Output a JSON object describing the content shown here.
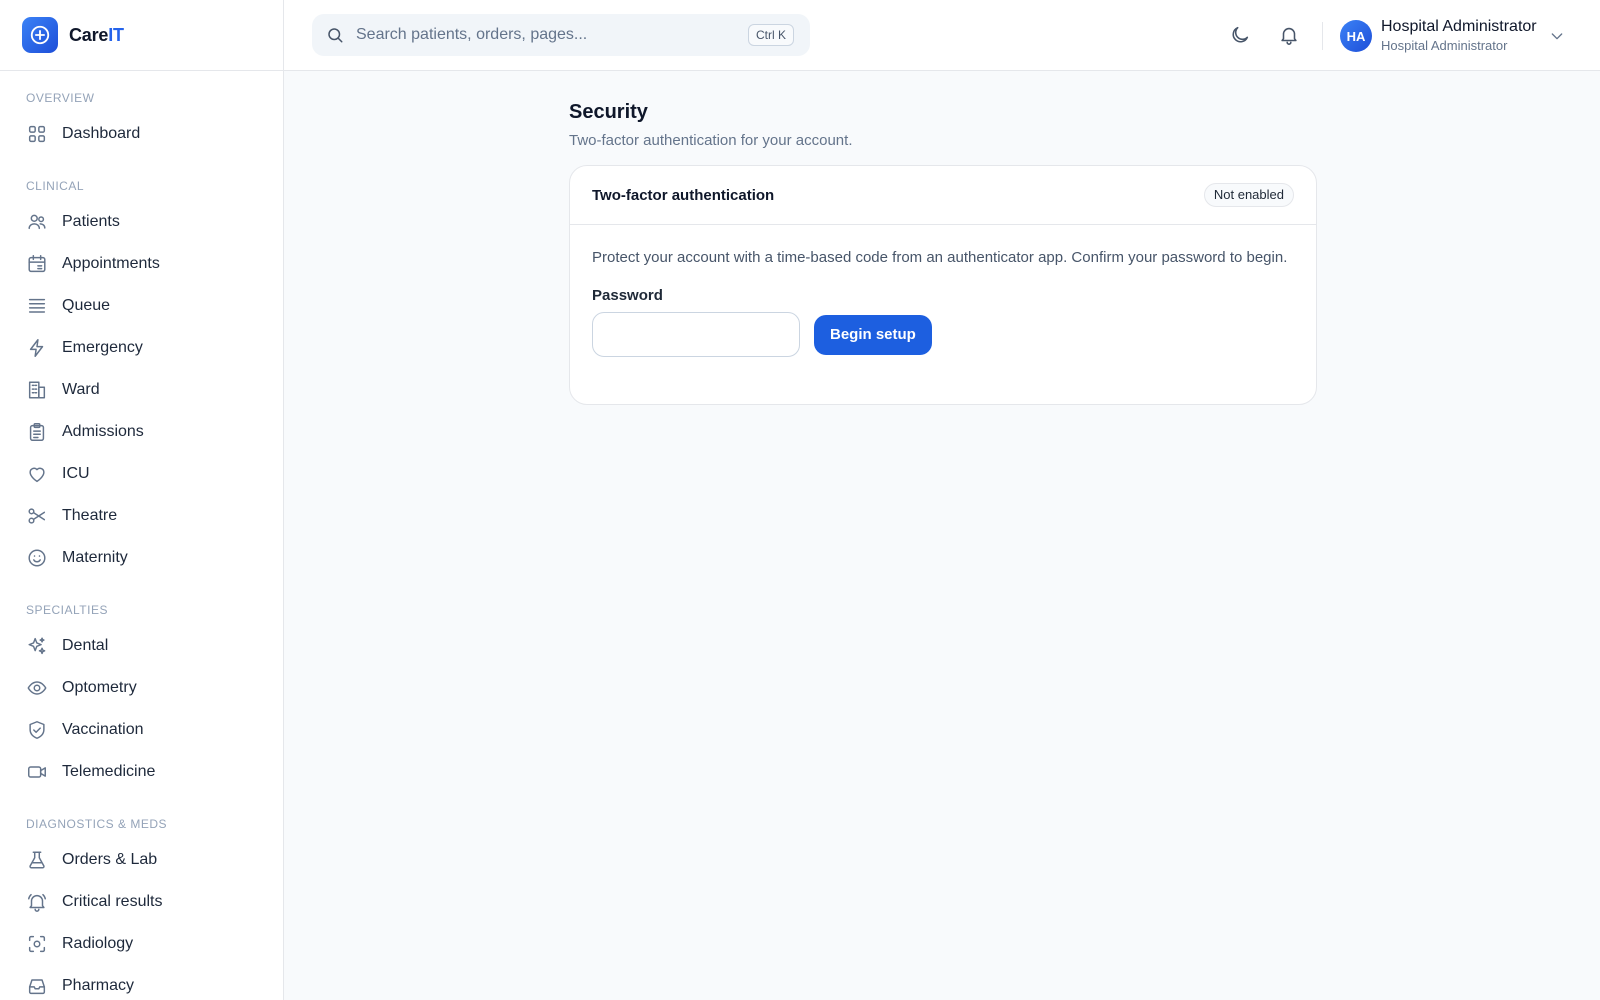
{
  "brand": {
    "name_main": "Care",
    "name_accent": "IT"
  },
  "search": {
    "placeholder": "Search patients, orders, pages...",
    "shortcut": "Ctrl K"
  },
  "user": {
    "initials": "HA",
    "name": "Hospital Administrator",
    "role": "Hospital Administrator"
  },
  "sidebar": {
    "sections": [
      {
        "label": "OVERVIEW",
        "items": [
          {
            "label": "Dashboard",
            "icon": "grid-icon"
          }
        ]
      },
      {
        "label": "CLINICAL",
        "items": [
          {
            "label": "Patients",
            "icon": "users-icon"
          },
          {
            "label": "Appointments",
            "icon": "calendar-icon"
          },
          {
            "label": "Queue",
            "icon": "list-icon"
          },
          {
            "label": "Emergency",
            "icon": "bolt-icon"
          },
          {
            "label": "Ward",
            "icon": "building-icon"
          },
          {
            "label": "Admissions",
            "icon": "clipboard-icon"
          },
          {
            "label": "ICU",
            "icon": "heart-icon"
          },
          {
            "label": "Theatre",
            "icon": "scissors-icon"
          },
          {
            "label": "Maternity",
            "icon": "smile-icon"
          }
        ]
      },
      {
        "label": "SPECIALTIES",
        "items": [
          {
            "label": "Dental",
            "icon": "sparkles-icon"
          },
          {
            "label": "Optometry",
            "icon": "eye-icon"
          },
          {
            "label": "Vaccination",
            "icon": "shield-check-icon"
          },
          {
            "label": "Telemedicine",
            "icon": "video-icon"
          }
        ]
      },
      {
        "label": "DIAGNOSTICS & MEDS",
        "items": [
          {
            "label": "Orders & Lab",
            "icon": "flask-icon"
          },
          {
            "label": "Critical results",
            "icon": "bell-alert-icon"
          },
          {
            "label": "Radiology",
            "icon": "scan-icon"
          },
          {
            "label": "Pharmacy",
            "icon": "inbox-icon"
          }
        ]
      }
    ]
  },
  "page": {
    "title": "Security",
    "subtitle": "Two-factor authentication for your account."
  },
  "card": {
    "title": "Two-factor authentication",
    "status": "Not enabled",
    "description": "Protect your account with a time-based code from an authenticator app. Confirm your password to begin.",
    "password_label": "Password",
    "password_value": "",
    "button_label": "Begin setup"
  },
  "colors": {
    "accent": "#1d5fe0",
    "icon": "#64748b"
  }
}
